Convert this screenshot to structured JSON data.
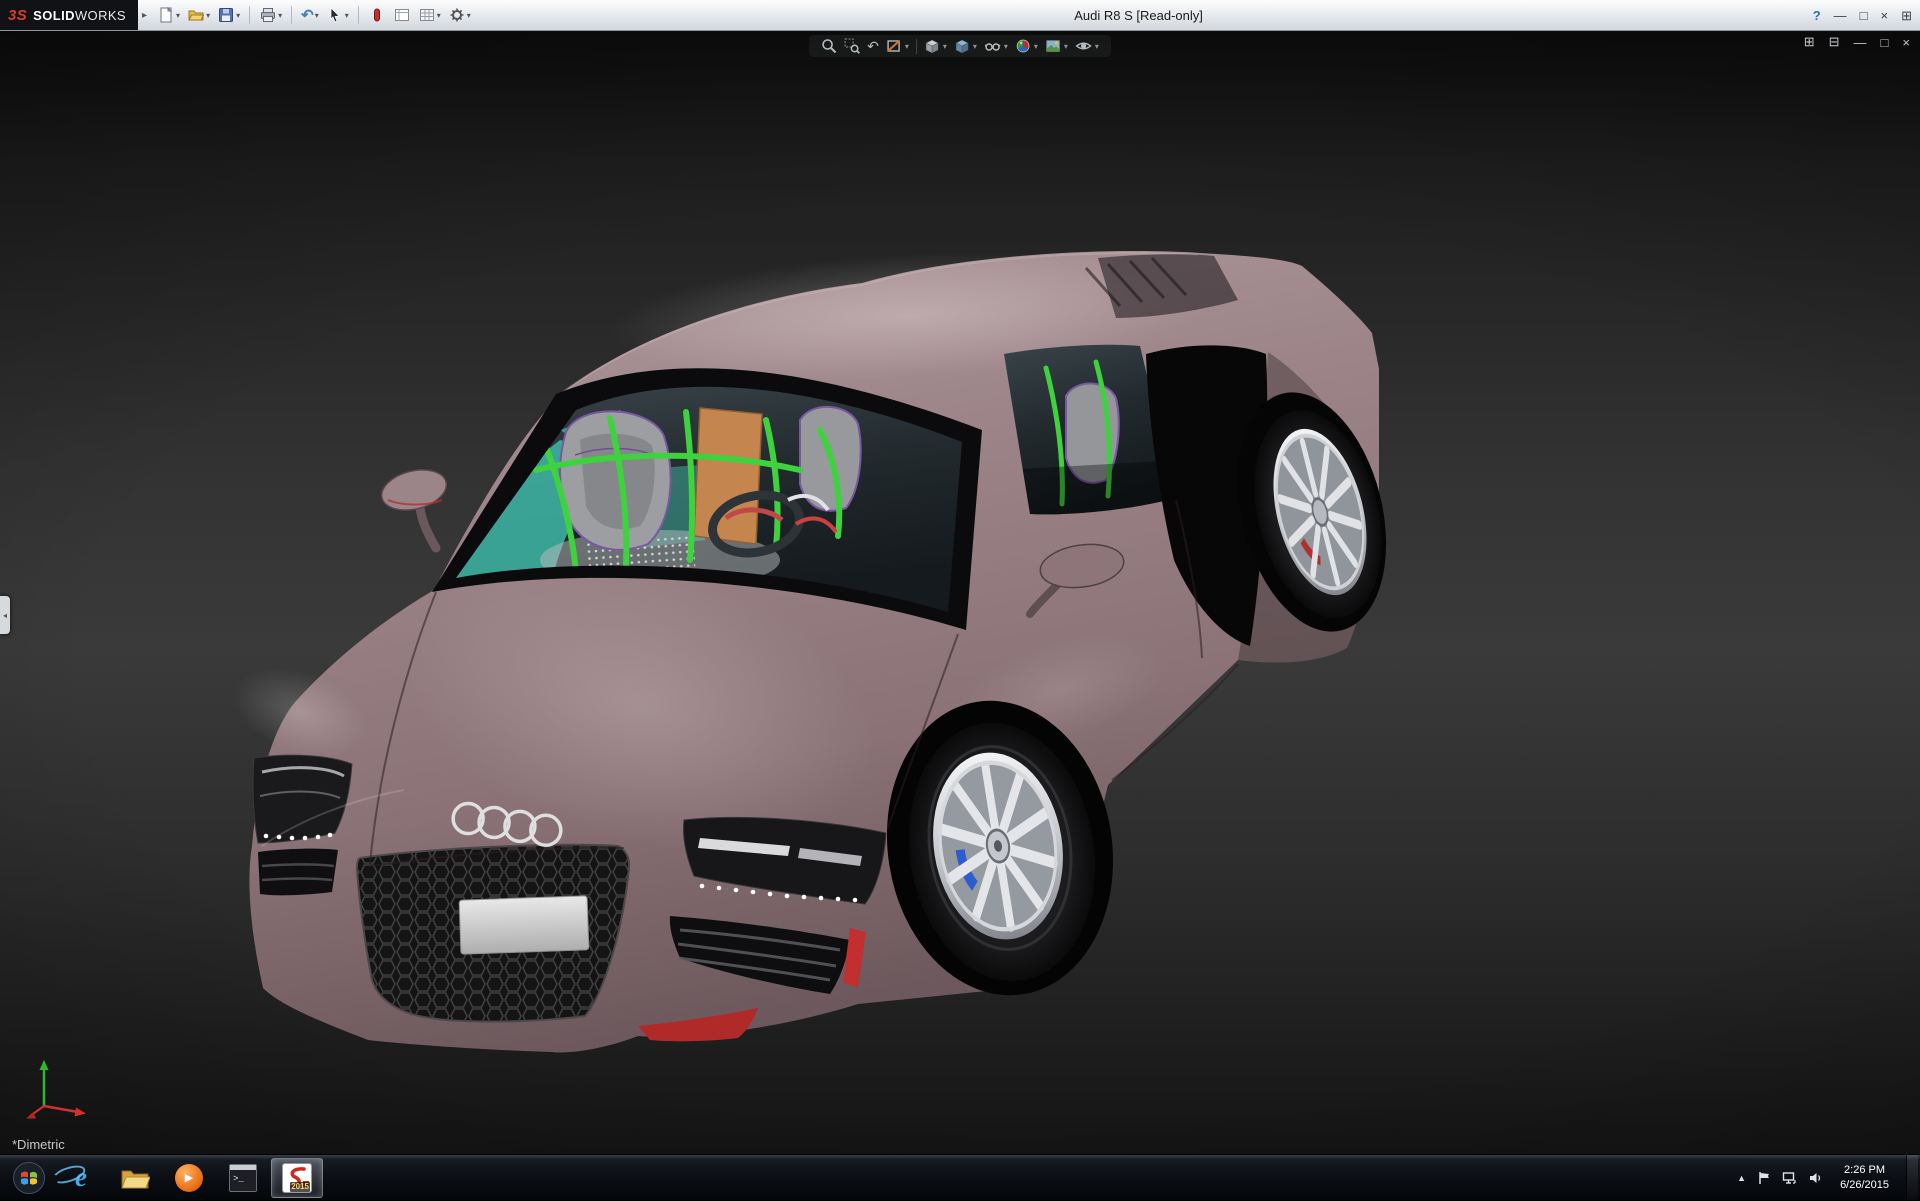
{
  "app": {
    "brand_short": "3S",
    "brand_bold": "SOLID",
    "brand_light": "WORKS",
    "title": "Audi R8 S [Read-only]"
  },
  "icons": {
    "caret": "▾",
    "flyout": "▸",
    "help": "?",
    "minimize": "—",
    "maximize": "□",
    "close": "×",
    "expand": "⊞",
    "undo": "↶",
    "previous_view": "↶",
    "tile_h": "⊞",
    "tile_v": "⊟",
    "collapse": "◂",
    "hidden": "▲",
    "play": "▶",
    "prompt": ">_",
    "ie": "e"
  },
  "standard_toolbar": {
    "items": [
      "new",
      "open",
      "save",
      "print",
      "undo",
      "select",
      "xpress",
      "sheet-format",
      "table",
      "options"
    ]
  },
  "hud_toolbar": {
    "items": [
      "zoom-to-fit",
      "zoom-to-area",
      "previous-view",
      "section-view",
      "view-orientation",
      "display-style",
      "hide-show-items",
      "edit-appearance",
      "apply-scene",
      "view-settings"
    ]
  },
  "doc_controls": {
    "items": [
      "tile-horizontal",
      "tile-vertical",
      "minimize",
      "restore",
      "close"
    ]
  },
  "viewport": {
    "orientation_label": "*Dimetric"
  },
  "model_colors": {
    "body": "#977f83",
    "cage_green": "#3ed23e",
    "seat_gray": "#9c9ea1",
    "seat_trim_purple": "#7b57a2",
    "panel_orange": "#c5854f",
    "dash_teal": "#3fb9a7",
    "accent_red": "#c22f2f",
    "caliper_blue": "#2d5bd0"
  },
  "taskbar": {
    "apps": [
      "internet-explorer",
      "file-explorer",
      "media-player",
      "command-prompt",
      "solidworks-2015"
    ],
    "solidworks_badge": "2015",
    "tray_time": "2:26 PM",
    "tray_date": "6/26/2015"
  }
}
